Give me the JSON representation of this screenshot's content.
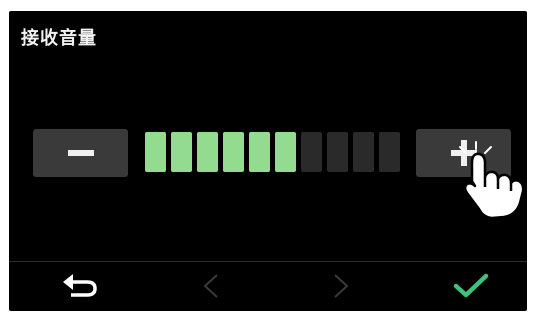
{
  "screen": {
    "title": "接收音量"
  },
  "volume": {
    "level": 6,
    "max": 10,
    "active_color": "#93dc8f",
    "inactive_color": "#2a2a2a"
  },
  "buttons": {
    "decrease_icon": "minus-icon",
    "increase_icon": "plus-icon"
  },
  "nav": {
    "back_icon": "return-arrow-icon",
    "prev_icon": "chevron-left-icon",
    "next_icon": "chevron-right-icon",
    "confirm_icon": "checkmark-icon",
    "confirm_color": "#3cc27c",
    "disabled_color": "#3a3a3a"
  }
}
